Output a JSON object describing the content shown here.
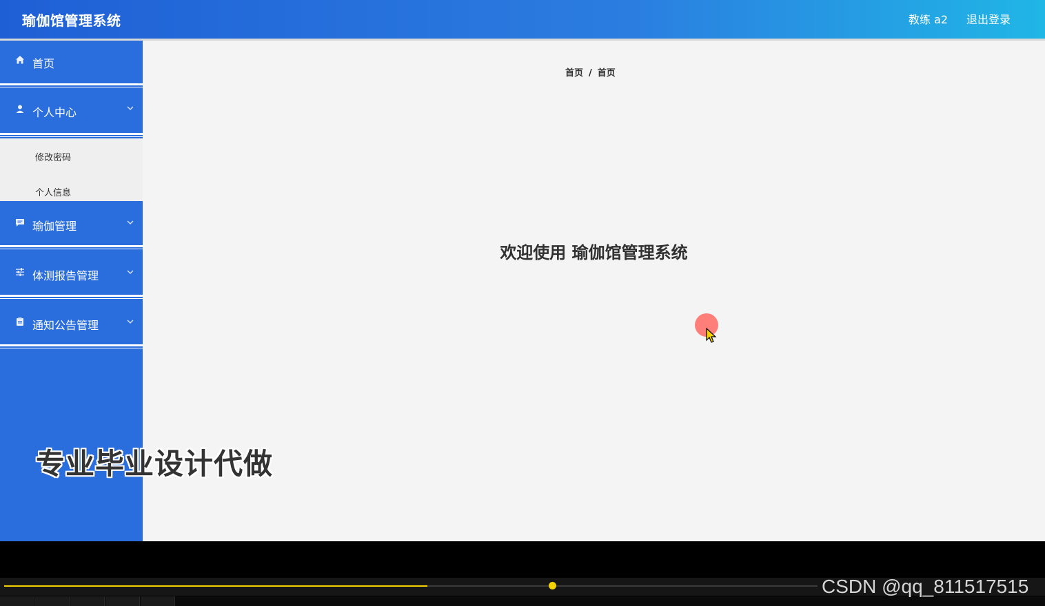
{
  "header": {
    "app_title": "瑜伽馆管理系统",
    "user_label": "教练 a2",
    "logout_label": "退出登录"
  },
  "sidebar": {
    "items": [
      {
        "label": "首页",
        "icon": "home-icon"
      },
      {
        "label": "个人中心",
        "icon": "user-icon"
      },
      {
        "label": "瑜伽管理",
        "icon": "chat-icon"
      },
      {
        "label": "体测报告管理",
        "icon": "sliders-icon"
      },
      {
        "label": "通知公告管理",
        "icon": "clipboard-icon"
      }
    ],
    "submenu": [
      "修改密码",
      "个人信息"
    ]
  },
  "breadcrumb": {
    "first": "首页",
    "separator": "/",
    "second": "首页"
  },
  "main": {
    "welcome": "欢迎使用 瑜伽馆管理系统"
  },
  "overlay": {
    "watermark": "专业毕业设计代做",
    "credit": "CSDN @qq_811517515"
  },
  "player": {
    "progress_fraction": 0.52,
    "accent_color": "#f5d300"
  },
  "colors": {
    "sidebar": "#2a6ddc",
    "header_start": "#1f5fd6",
    "header_end": "#20b6e6",
    "content_bg": "#f4f4f4"
  }
}
